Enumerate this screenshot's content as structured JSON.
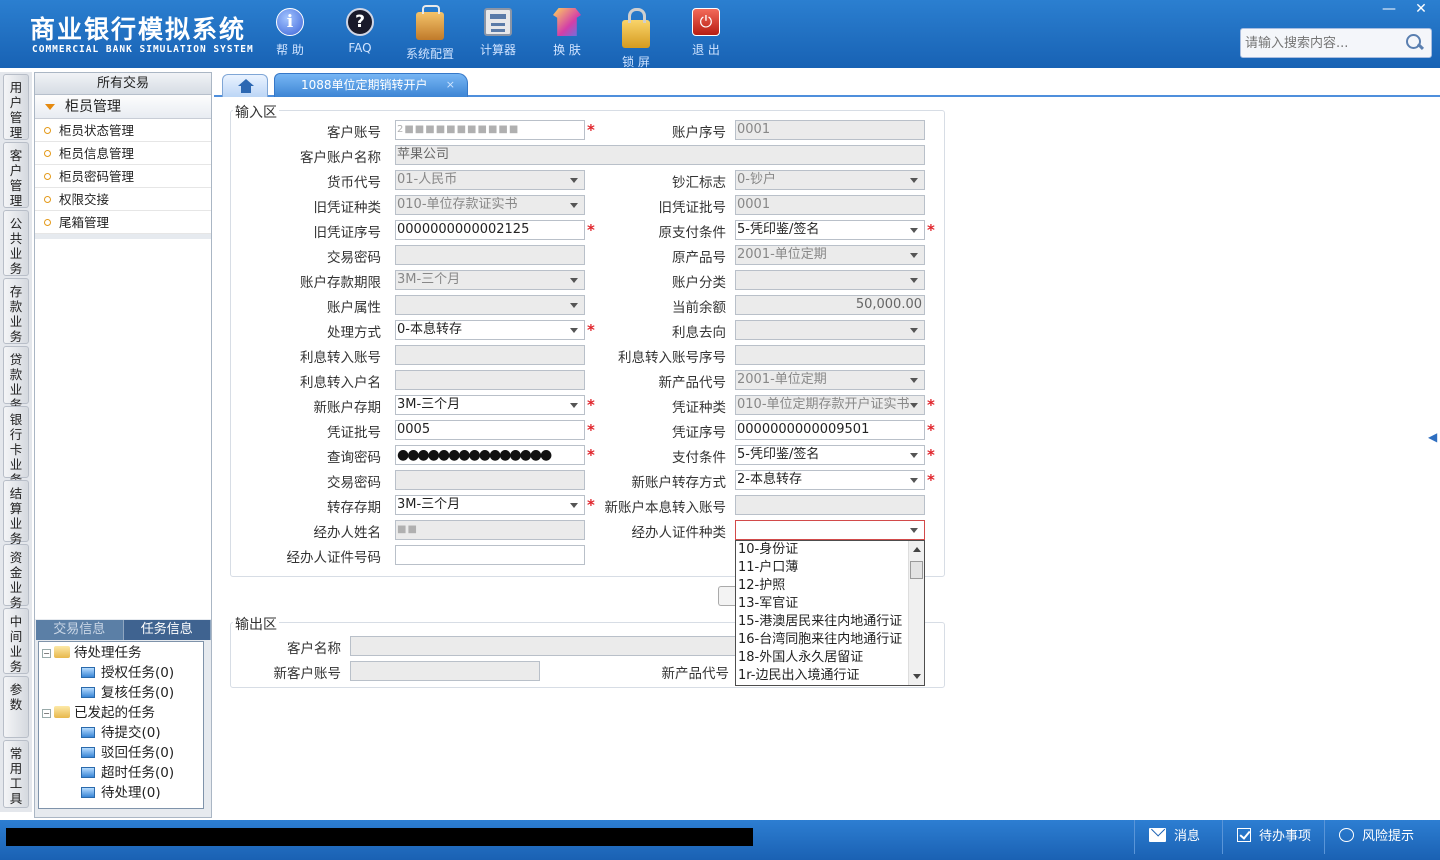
{
  "header": {
    "brand_cn": "商业银行模拟系统",
    "brand_en": "COMMERCIAL BANK SIMULATION SYSTEM",
    "tools": [
      {
        "label": "帮 助",
        "icon": "help-icon"
      },
      {
        "label": "FAQ",
        "icon": "faq-icon"
      },
      {
        "label": "系统配置",
        "icon": "toolbox-icon"
      },
      {
        "label": "计算器",
        "icon": "calculator-icon"
      },
      {
        "label": "换 肤",
        "icon": "shirt-icon"
      },
      {
        "label": "锁 屏",
        "icon": "lock-icon"
      },
      {
        "label": "退 出",
        "icon": "power-icon"
      }
    ],
    "window_minimize": "—",
    "window_close": "✕",
    "search_placeholder": "请输入搜索内容..."
  },
  "vtabs": [
    "用户管理",
    "客户管理",
    "公共业务",
    "存款业务",
    "贷款业务",
    "银行卡业务",
    "结算业务",
    "资金业务",
    "中间业务",
    "参数",
    "常用工具"
  ],
  "sidebar": {
    "header": "所有交易",
    "group": "柜员管理",
    "items": [
      "柜员状态管理",
      "柜员信息管理",
      "柜员密码管理",
      "权限交接",
      "尾箱管理"
    ],
    "tabs": [
      "交易信息",
      "任务信息"
    ],
    "tree": {
      "pending": "待处理任务",
      "pending_items": [
        "授权任务(0)",
        "复核任务(0)"
      ],
      "initiated": "已发起的任务",
      "initiated_items": [
        "待提交(0)",
        "驳回任务(0)",
        "超时任务(0)",
        "待处理(0)"
      ]
    }
  },
  "tabs": {
    "active": "1088单位定期销转开户",
    "close": "×"
  },
  "input": {
    "title": "输入区",
    "l": {
      "cust_acct": "客户账号",
      "acct_seq": "账户序号",
      "acct_name": "客户账户名称",
      "currency": "货币代号",
      "cash_flag": "钞汇标志",
      "old_vtype": "旧凭证种类",
      "old_vbatch": "旧凭证批号",
      "old_vno": "旧凭证序号",
      "old_pay": "原支付条件",
      "trade_pwd": "交易密码",
      "orig_prod": "原产品号",
      "term": "账户存款期限",
      "acct_class": "账户分类",
      "acct_attr": "账户属性",
      "balance": "当前余额",
      "proc": "处理方式",
      "int_dir": "利息去向",
      "int_acct": "利息转入账号",
      "int_seq": "利息转入账号序号",
      "int_name": "利息转入户名",
      "new_prod": "新产品代号",
      "new_term": "新账户存期",
      "vtype": "凭证种类",
      "vbatch": "凭证批号",
      "vno": "凭证序号",
      "query_pwd": "查询密码",
      "pay_cond": "支付条件",
      "trade_pwd2": "交易密码",
      "new_transfer": "新账户转存方式",
      "roll_term": "转存存期",
      "new_int_acct": "新账户本息转入账号",
      "agent_name": "经办人姓名",
      "agent_idtype": "经办人证件种类",
      "agent_idno": "经办人证件号码"
    },
    "v": {
      "cust_acct": "2■■■■■■■■■■■",
      "acct_seq": "0001",
      "acct_name": "苹果公司",
      "currency": "01-人民币",
      "cash_flag": "0-钞户",
      "old_vtype": "010-单位存款证实书",
      "old_vbatch": "0001",
      "old_vno": "0000000000002125",
      "old_pay": "5-凭印鉴/签名",
      "trade_pwd": "",
      "orig_prod": "2001-单位定期",
      "term": "3M-三个月",
      "acct_class": "",
      "acct_attr": "",
      "balance": "50,000.00",
      "proc": "0-本息转存",
      "int_dir": "",
      "int_acct": "",
      "int_seq": "",
      "int_name": "",
      "new_prod": "2001-单位定期",
      "new_term": "3M-三个月",
      "vtype": "010-单位定期存款开户证实书",
      "vbatch": "0005",
      "vno": "0000000000009501",
      "query_pwd": "●●●●●●●●●●●●●●●",
      "pay_cond": "5-凭印鉴/签名",
      "trade_pwd2": "",
      "new_transfer": "2-本息转存",
      "roll_term": "3M-三个月",
      "new_int_acct": "",
      "agent_name": "■■",
      "agent_idtype": "",
      "agent_idno": ""
    },
    "required_mark": "*"
  },
  "dropdown": [
    "10-身份证",
    "11-户口薄",
    "12-护照",
    "13-军官证",
    "15-港澳居民来往内地通行证",
    "16-台湾同胞来往内地通行证",
    "18-外国人永久居留证",
    "1r-边民出入境通行证"
  ],
  "output": {
    "title": "输出区",
    "l": {
      "cust_name": "客户名称",
      "new_acct": "新客户账号",
      "new_prod": "新产品代号"
    },
    "v": {
      "cust_name": "",
      "new_acct": "",
      "new_prod": ""
    }
  },
  "footer": {
    "msg": "消息",
    "todo": "待办事项",
    "risk": "风险提示"
  }
}
